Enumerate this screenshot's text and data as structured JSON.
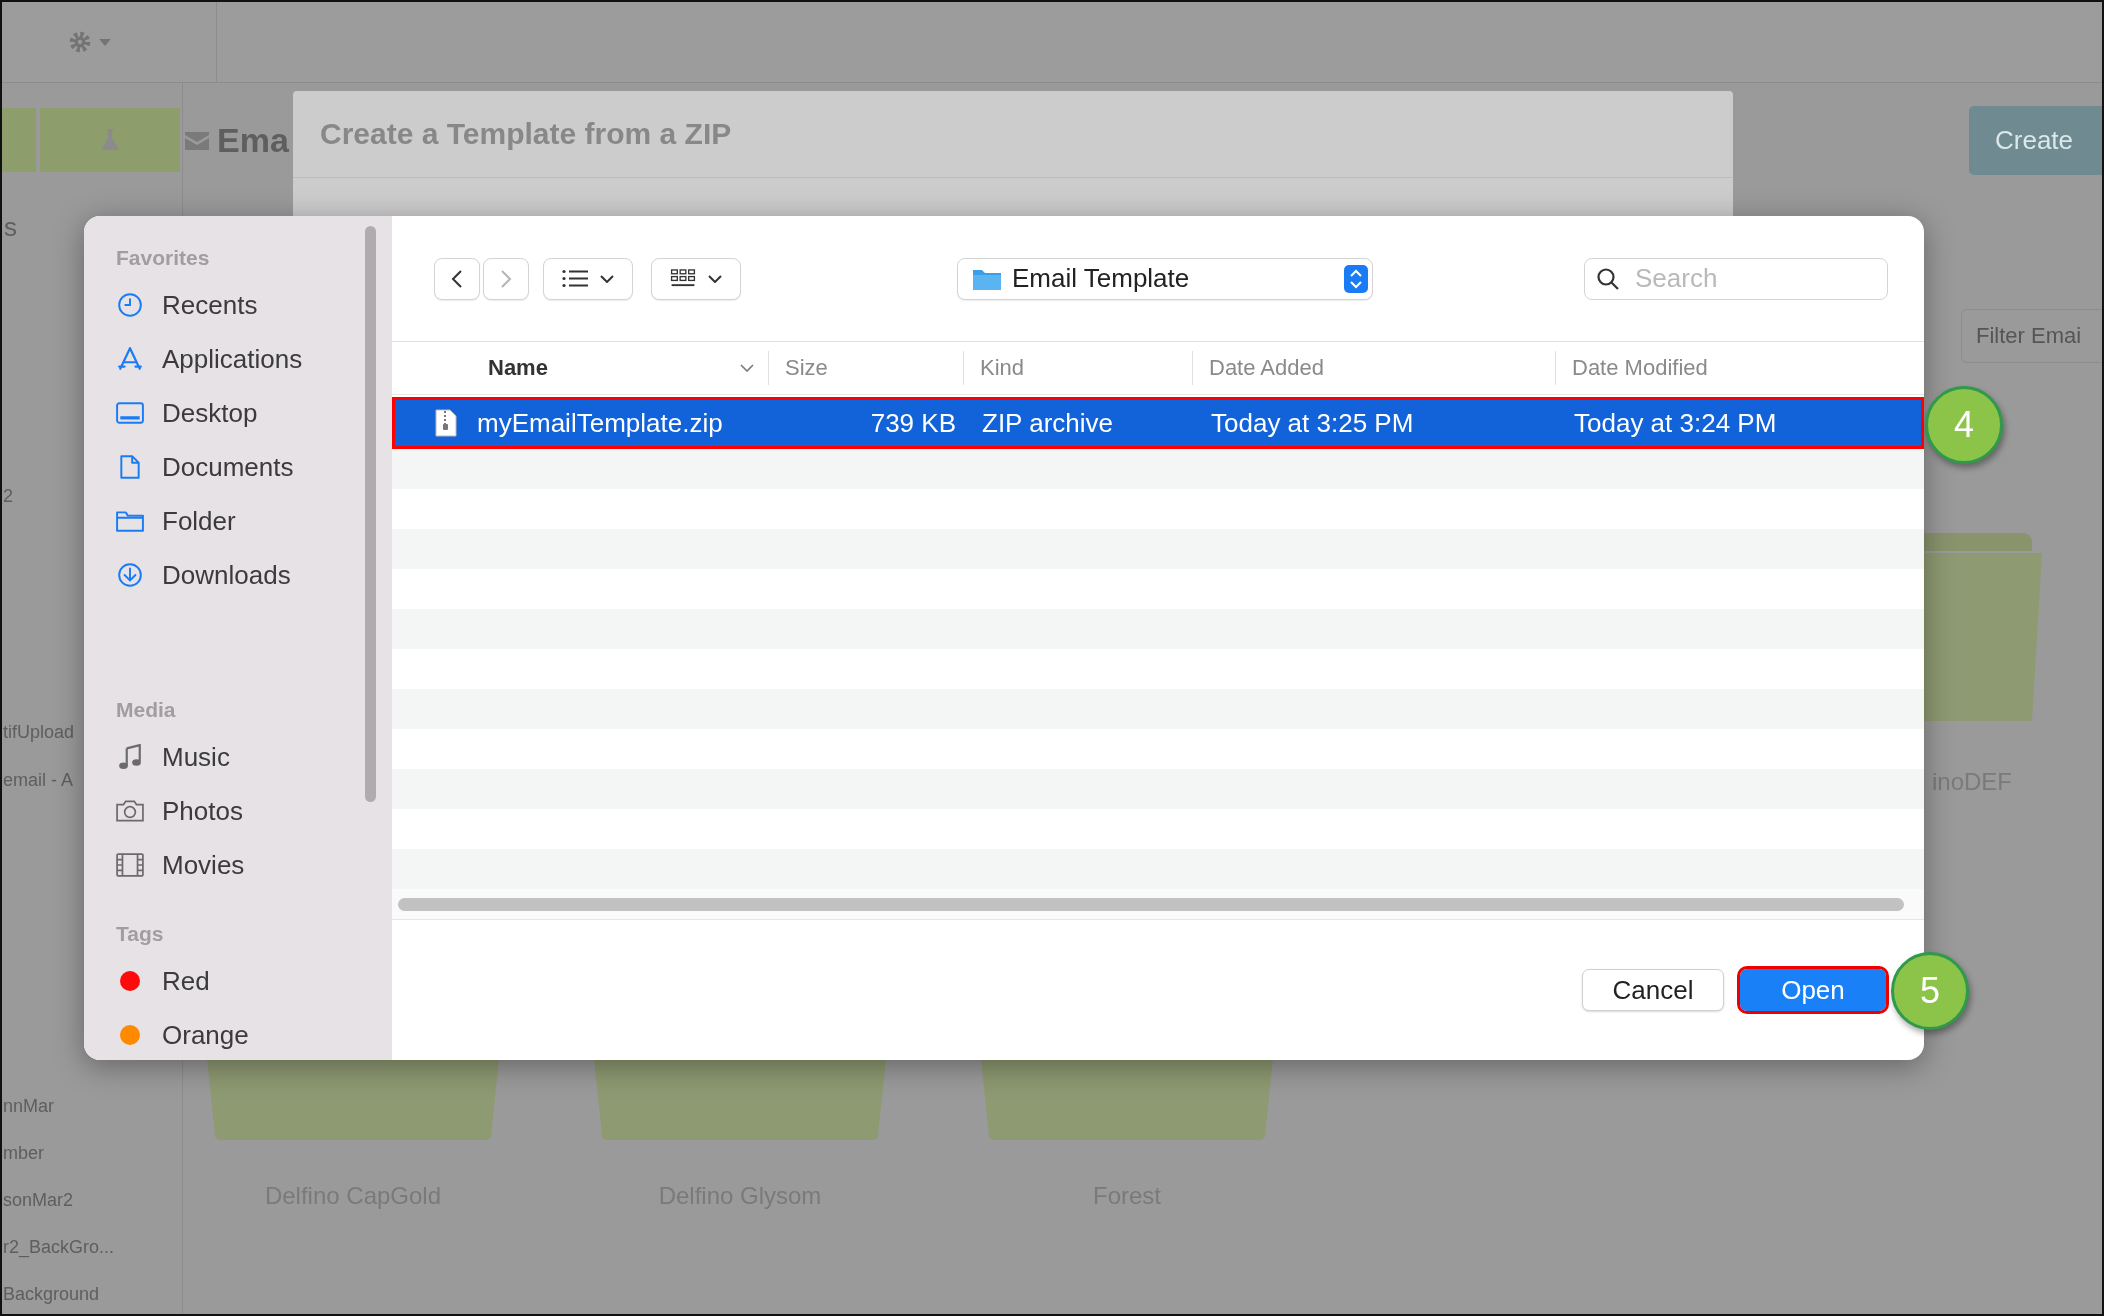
{
  "background_app": {
    "left_panel": {
      "heading": "s",
      "items": [
        {
          "label": "2"
        },
        {
          "label": "tifUpload"
        },
        {
          "label": "email - A"
        },
        {
          "label": "nnMar"
        },
        {
          "label": "mber"
        },
        {
          "label": "sonMar2"
        },
        {
          "label": "r2_BackGro..."
        },
        {
          "label": "Background"
        }
      ]
    },
    "heading": "Ema",
    "create_button": "Create",
    "filter": {
      "placeholder": "Filter Emai"
    },
    "side_folder": {
      "name": "inoDEF"
    },
    "folders": [
      {
        "name": "Delfino CapGold"
      },
      {
        "name": "Delfino Glysom"
      },
      {
        "name": "Forest"
      }
    ]
  },
  "modal": {
    "title": "Create a Template from a ZIP"
  },
  "file_dialog": {
    "sidebar": [
      {
        "title": "Favorites",
        "items": [
          {
            "label": "Recents",
            "kind": "clock"
          },
          {
            "label": "Applications",
            "kind": "apps"
          },
          {
            "label": "Desktop",
            "kind": "desktop"
          },
          {
            "label": "Documents",
            "kind": "document"
          },
          {
            "label": "Folder",
            "kind": "folder"
          },
          {
            "label": "Downloads",
            "kind": "download"
          }
        ]
      },
      {
        "title": "Media",
        "items": [
          {
            "label": "Music",
            "kind": "music"
          },
          {
            "label": "Photos",
            "kind": "camera"
          },
          {
            "label": "Movies",
            "kind": "film"
          }
        ]
      },
      {
        "title": "Tags",
        "items": [
          {
            "label": "Red",
            "kind": "tag",
            "color": "#ff0a0a"
          },
          {
            "label": "Orange",
            "kind": "tag",
            "color": "#ff8a00"
          }
        ]
      }
    ],
    "location": "Email Template",
    "search": {
      "placeholder": "Search"
    },
    "columns": [
      {
        "label": "Name",
        "sorted": true
      },
      {
        "label": "Size",
        "sorted": false
      },
      {
        "label": "Kind",
        "sorted": false
      },
      {
        "label": "Date Added",
        "sorted": false
      },
      {
        "label": "Date Modified",
        "sorted": false
      }
    ],
    "rows": [
      {
        "name": "myEmailTemplate.zip",
        "size": "739 KB",
        "kind": "ZIP archive",
        "date_added": "Today at 3:25 PM",
        "date_modified": "Today at 3:24 PM",
        "selected": true,
        "highlighted": true,
        "step": "4"
      }
    ],
    "buttons": [
      {
        "label": "Cancel",
        "kind": "cancel",
        "highlighted": false
      },
      {
        "label": "Open",
        "kind": "default",
        "highlighted": true,
        "step": "5"
      }
    ]
  }
}
